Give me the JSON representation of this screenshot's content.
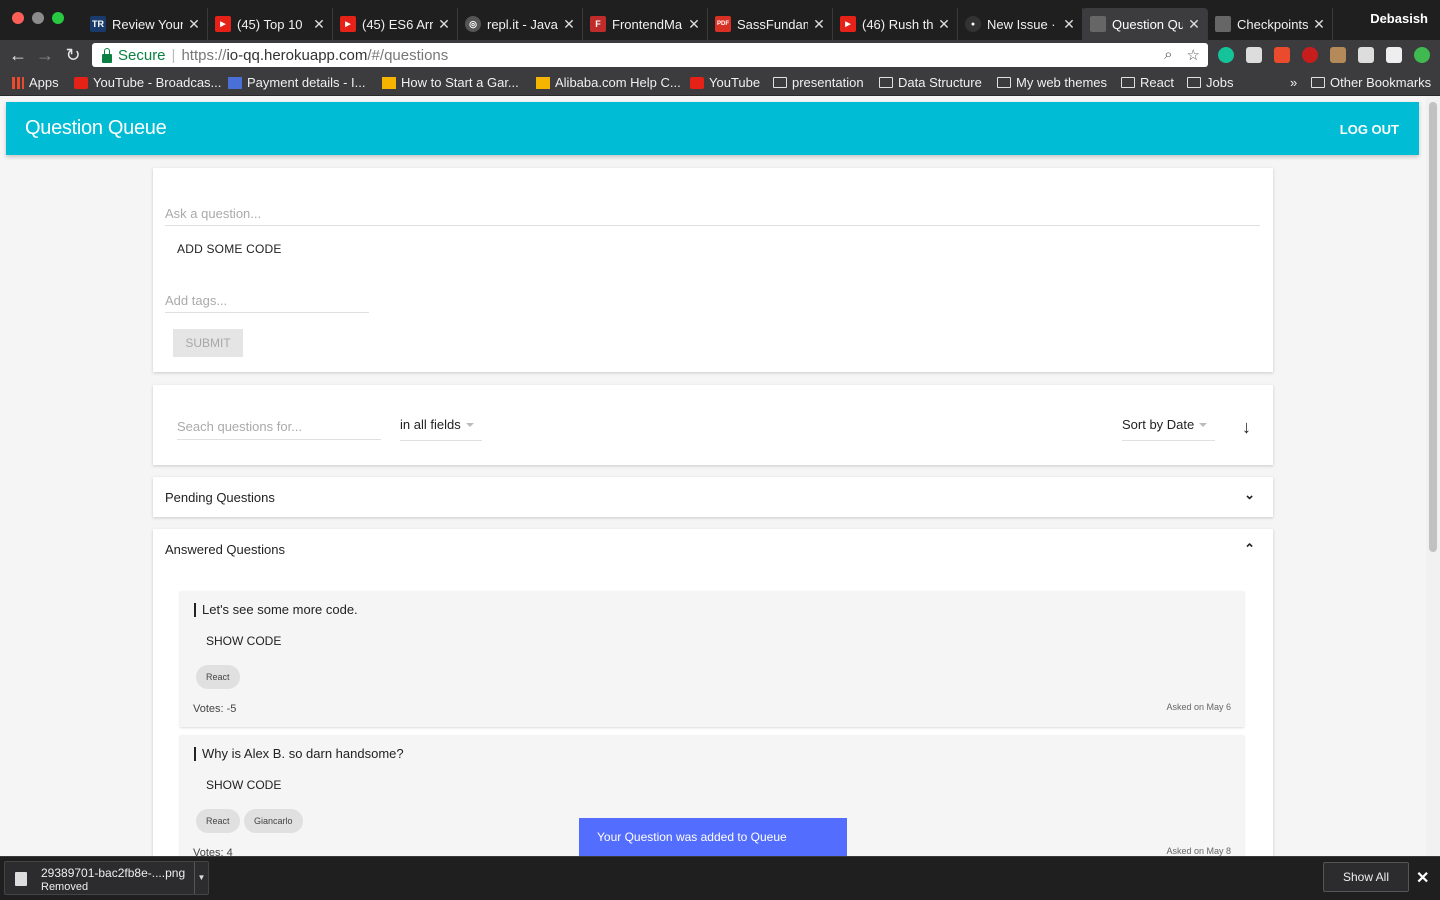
{
  "browser": {
    "tabs": [
      {
        "label": "Review Your",
        "favicon": "TR",
        "favicon_color": "#1a3a6b"
      },
      {
        "label": "(45) Top 10",
        "favicon": "▶",
        "favicon_color": "#e62117"
      },
      {
        "label": "(45) ES6 Arr",
        "favicon": "▶",
        "favicon_color": "#e62117"
      },
      {
        "label": "repl.it - Java",
        "favicon": "◎",
        "favicon_color": "#555555"
      },
      {
        "label": "FrontendMa",
        "favicon": "F",
        "favicon_color": "#c02c2c"
      },
      {
        "label": "SassFundam",
        "favicon": "PDF",
        "favicon_color": "#d93025"
      },
      {
        "label": "(46) Rush th",
        "favicon": "▶",
        "favicon_color": "#e62117"
      },
      {
        "label": "New Issue · G",
        "favicon": "●",
        "favicon_color": "#333333"
      },
      {
        "label": "Question Qu",
        "favicon": "",
        "favicon_color": "#777777"
      },
      {
        "label": "Checkpoints",
        "favicon": "",
        "favicon_color": "#777777"
      }
    ],
    "profile_name": "Debasish",
    "secure_label": "Secure",
    "url_scheme": "https://",
    "url_host": "io-qq.herokuapp.com",
    "url_path": "/#/questions",
    "bookmarks": [
      {
        "label": "Apps",
        "icon": "apps-grid-icon"
      },
      {
        "label": "YouTube - Broadcas...",
        "icon": "youtube-icon"
      },
      {
        "label": "Payment details - I...",
        "icon": "page-icon"
      },
      {
        "label": "How to Start a Gar...",
        "icon": "bookmark-icon"
      },
      {
        "label": "Alibaba.com Help C...",
        "icon": "bookmark-icon"
      },
      {
        "label": "YouTube",
        "icon": "youtube-icon"
      },
      {
        "label": "presentation",
        "icon": "folder-icon"
      },
      {
        "label": "Data Structure",
        "icon": "folder-icon"
      },
      {
        "label": "My web themes",
        "icon": "folder-icon"
      },
      {
        "label": "React",
        "icon": "folder-icon"
      },
      {
        "label": "Jobs",
        "icon": "folder-icon"
      }
    ],
    "bookmarks_overflow": "»",
    "other_bookmarks": "Other Bookmarks"
  },
  "app": {
    "title": "Question Queue",
    "logout_label": "LOG OUT",
    "accent_color": "#00bcd4"
  },
  "ask_form": {
    "question_placeholder": "Ask a question...",
    "add_code_label": "ADD SOME CODE",
    "tags_placeholder": "Add tags...",
    "submit_label": "SUBMIT"
  },
  "search": {
    "placeholder": "Seach questions for...",
    "field_filter": "in all fields",
    "sort_label": "Sort by Date"
  },
  "sections": {
    "pending_title": "Pending Questions",
    "answered_title": "Answered Questions"
  },
  "answered_questions": [
    {
      "text": "Let's see some more code.",
      "show_code_label": "SHOW CODE",
      "tags": [
        "React"
      ],
      "votes": "Votes: -5",
      "asked": "Asked on May 6"
    },
    {
      "text": "Why is Alex B. so darn handsome?",
      "show_code_label": "SHOW CODE",
      "tags": [
        "React",
        "Giancarlo"
      ],
      "votes": "Votes: 4",
      "asked": "Asked on May 8"
    }
  ],
  "snackbar": {
    "message": "Your Question was added to Queue",
    "color": "#536dfe"
  },
  "downloads": {
    "file_name": "29389701-bac2fb8e-....png",
    "status": "Removed",
    "show_all_label": "Show All"
  }
}
